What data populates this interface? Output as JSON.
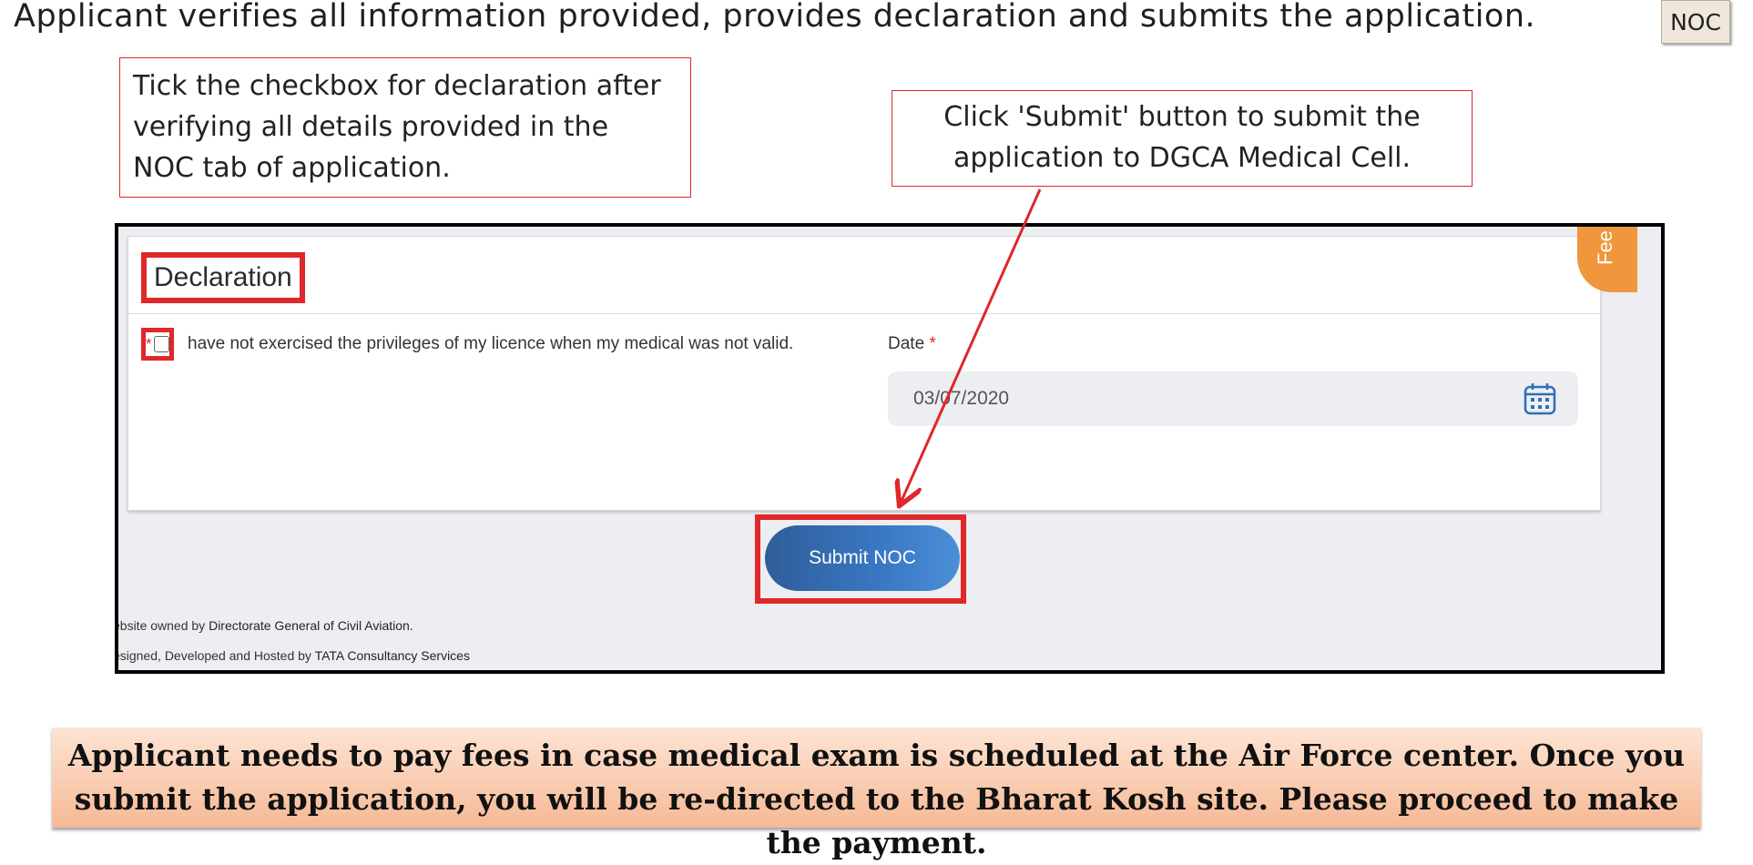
{
  "slide": {
    "title": "Applicant verifies all information provided, provides declaration and submits the application.",
    "tag": "NOC"
  },
  "callouts": {
    "checkbox_hint": "Tick the checkbox for declaration after verifying all details provided in the NOC tab of application.",
    "submit_hint": "Click 'Submit' button to submit the application to DGCA Medical Cell."
  },
  "form": {
    "section_title": "Declaration",
    "required_mark": "*",
    "declaration_text": "have not exercised the privileges of my licence when my medical was not valid.",
    "declaration_checked": false,
    "date_label": "Date",
    "date_value": "03/07/2020",
    "fee_tab_label": "Fee",
    "submit_label": "Submit NOC"
  },
  "footer": {
    "line1_prefix": "ebsite owned by",
    "line1_owner": "Directorate General of Civil Aviation.",
    "line2_prefix": "esigned, Developed and Hosted by",
    "line2_owner": "TATA Consultancy Services"
  },
  "banner": {
    "text": "Applicant needs to pay fees in case medical exam is scheduled at the Air Force center. Once you submit the application, you will be re-directed to the Bharat Kosh site. Please proceed to make the payment."
  },
  "colors": {
    "highlight": "#e0272a",
    "button": "#3a78c4",
    "fee_tab": "#f0963c"
  }
}
